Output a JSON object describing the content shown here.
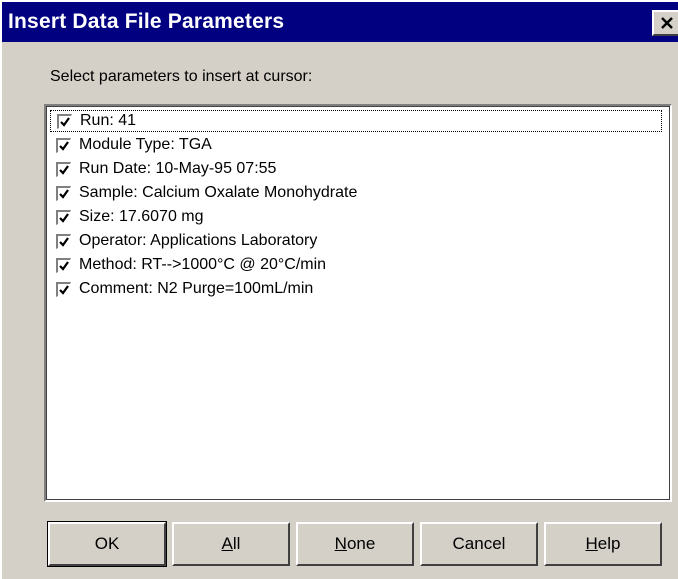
{
  "window": {
    "title": "Insert Data File Parameters",
    "close_icon": "close-icon"
  },
  "prompt": "Select parameters to insert at cursor:",
  "parameters": [
    {
      "label": "Run:  41",
      "checked": true
    },
    {
      "label": "Module Type:  TGA",
      "checked": true
    },
    {
      "label": "Run Date:  10-May-95 07:55",
      "checked": true
    },
    {
      "label": "Sample:  Calcium Oxalate Monohydrate",
      "checked": true
    },
    {
      "label": "Size:  17.6070  mg",
      "checked": true
    },
    {
      "label": "Operator:  Applications Laboratory",
      "checked": true
    },
    {
      "label": "Method:  RT-->1000°C @ 20°C/min",
      "checked": true
    },
    {
      "label": "Comment:  N2 Purge=100mL/min",
      "checked": true
    }
  ],
  "buttons": {
    "ok": "OK",
    "all_accel": "A",
    "all_rest": "ll",
    "none_accel": "N",
    "none_rest": "one",
    "cancel": "Cancel",
    "help_accel": "H",
    "help_rest": "elp"
  }
}
